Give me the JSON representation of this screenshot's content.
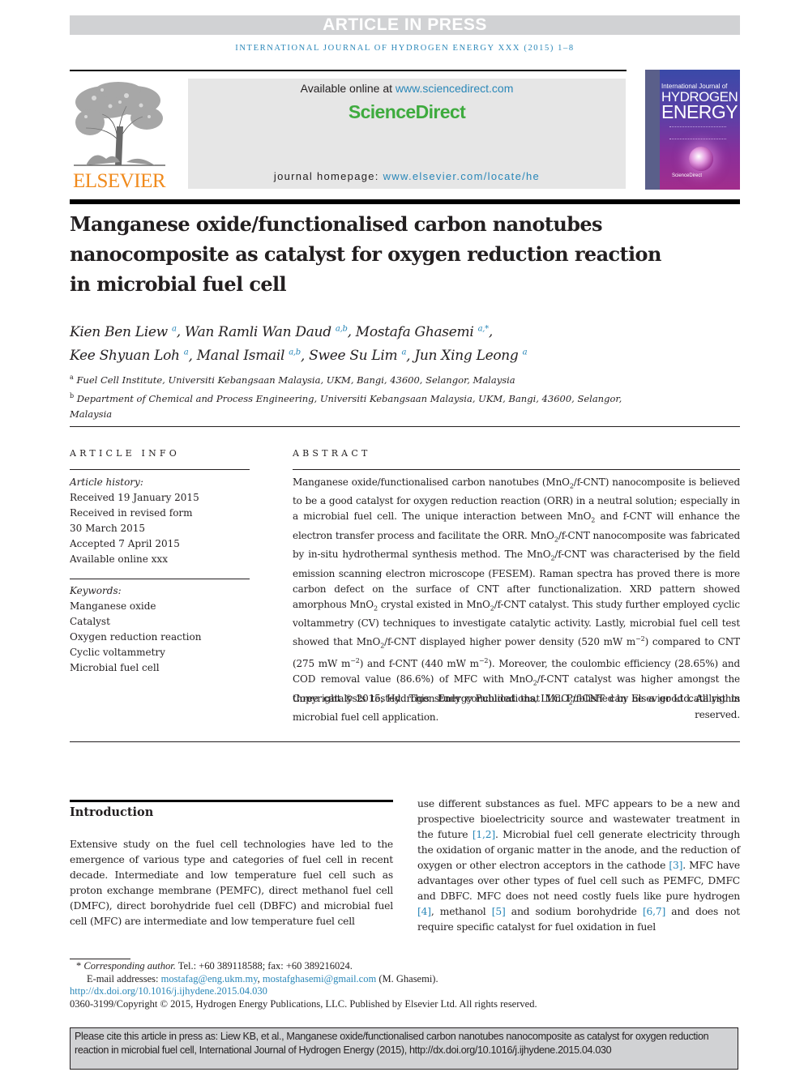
{
  "banner": {
    "label": "ARTICLE IN PRESS"
  },
  "running_head": "International Journal of Hydrogen Energy xxx (2015) 1–8",
  "masthead": {
    "publisher_word": "ELSEVIER",
    "available_prefix": "Available online at ",
    "available_link": "www.sciencedirect.com",
    "brand": "ScienceDirect",
    "homepage_prefix": "journal homepage: ",
    "homepage_link": "www.elsevier.com/locate/he",
    "cover": {
      "line1": "International Journal of",
      "line2": "HYDROGEN",
      "line3": "ENERGY",
      "footer": "ScienceDirect"
    }
  },
  "article": {
    "title": "Manganese oxide/functionalised carbon nanotubes nanocomposite as catalyst for oxygen reduction reaction in microbial fuel cell",
    "authors": [
      {
        "name": "Kien Ben Liew",
        "aff": "a",
        "sep": ", "
      },
      {
        "name": "Wan Ramli Wan Daud",
        "aff": "a,b",
        "sep": ", "
      },
      {
        "name": "Mostafa Ghasemi",
        "aff": "a,*",
        "sep": ","
      },
      {
        "name": "Kee Shyuan Loh",
        "aff": "a",
        "sep": ", "
      },
      {
        "name": "Manal Ismail",
        "aff": "a,b",
        "sep": ", "
      },
      {
        "name": "Swee Su Lim",
        "aff": "a",
        "sep": ", "
      },
      {
        "name": "Jun Xing Leong",
        "aff": "a",
        "sep": ""
      }
    ],
    "affiliations": [
      {
        "key": "a",
        "text": "Fuel Cell Institute, Universiti Kebangsaan Malaysia, UKM, Bangi, 43600, Selangor, Malaysia"
      },
      {
        "key": "b",
        "text": "Department of Chemical and Process Engineering, Universiti Kebangsaan Malaysia, UKM, Bangi, 43600, Selangor, Malaysia"
      }
    ]
  },
  "article_info": {
    "heading": "ARTICLE INFO",
    "history_label": "Article history:",
    "history": [
      "Received 19 January 2015",
      "Received in revised form",
      "30 March 2015",
      "Accepted 7 April 2015",
      "Available online xxx"
    ],
    "keywords_label": "Keywords:",
    "keywords": [
      "Manganese oxide",
      "Catalyst",
      "Oxygen reduction reaction",
      "Cyclic voltammetry",
      "Microbial fuel cell"
    ]
  },
  "abstract": {
    "heading": "ABSTRACT",
    "segments": [
      "Manganese oxide/functionalised carbon nanotubes (MnO",
      "2",
      "/f-CNT) nanocomposite is believed to be a good catalyst for oxygen reduction reaction (ORR) in a neutral solution; especially in a microbial fuel cell. The unique interaction between MnO",
      "2",
      " and f-CNT will enhance the electron transfer process and facilitate the ORR. MnO",
      "2",
      "/f-CNT nanocomposite was fabricated by in-situ hydrothermal synthesis method. The MnO",
      "2",
      "/f-CNT was characterised by the field emission scanning electron microscope (FESEM). Raman spectra has proved there is more carbon defect on the surface of CNT after functionalization. XRD pattern showed amorphous MnO",
      "2",
      " crystal existed in MnO",
      "2",
      "/f-CNT catalyst. This study further employed cyclic voltammetry (CV) techniques to investigate catalytic activity. Lastly, microbial fuel cell test showed that MnO",
      "2",
      "/f-CNT displayed higher power density (520 mW m",
      "−2",
      ") compared to CNT (275 mW m",
      "−2",
      ") and f-CNT (440 mW m",
      "−2",
      "). Moreover, the coulombic efficiency (28.65%) and COD removal value (86.6%) of MFC with MnO",
      "2",
      "/f-CNT catalyst was higher amongst the three catalysts tested. This study concluded that MnO",
      "2",
      "/f-CNT can be a good catalyst in microbial fuel cell application."
    ],
    "copyright": "Copyright © 2015, Hydrogen Energy Publications, LLC. Published by Elsevier Ltd. All rights reserved."
  },
  "introduction": {
    "heading": "Introduction",
    "col1": "Extensive study on the fuel cell technologies have led to the emergence of various type and categories of fuel cell in recent decade. Intermediate and low temperature fuel cell such as proton exchange membrane (PEMFC), direct methanol fuel cell (DMFC), direct borohydride fuel cell (DBFC) and microbial fuel cell (MFC) are intermediate and low temperature fuel cell",
    "col2": [
      {
        "t": "use different substances as fuel. MFC appears to be a new and prospective bioelectricity source and wastewater treatment in the future "
      },
      {
        "ref": "[1,2]"
      },
      {
        "t": ". Microbial fuel cell generate electricity through the oxidation of organic matter in the anode, and the reduction of oxygen or other electron acceptors in the cathode "
      },
      {
        "ref": "[3]"
      },
      {
        "t": ". MFC have advantages over other types of fuel cell such as PEMFC, DMFC and DBFC. MFC does not need costly fuels like pure hydrogen "
      },
      {
        "ref": "[4]"
      },
      {
        "t": ", methanol "
      },
      {
        "ref": "[5]"
      },
      {
        "t": " and sodium borohydride "
      },
      {
        "ref": "[6,7]"
      },
      {
        "t": " and does not require specific catalyst for fuel oxidation in fuel"
      }
    ]
  },
  "footnotes": {
    "star": "*",
    "corresponding_label": "Corresponding author.",
    "contact": " Tel.: +60 389118588; fax: +60 389216024.",
    "email_prefix": "E-mail addresses: ",
    "email1": "mostafag@eng.ukm.my",
    "email_sep": ", ",
    "email2": "mostafghasemi@gmail.com",
    "email_suffix": " (M. Ghasemi).",
    "doi": "http://dx.doi.org/10.1016/j.ijhydene.2015.04.030",
    "issn_copyright": "0360-3199/Copyright © 2015, Hydrogen Energy Publications, LLC. Published by Elsevier Ltd. All rights reserved."
  },
  "citation_box": {
    "text": "Please cite this article in press as: Liew KB, et al., Manganese oxide/functionalised carbon nanotubes nanocomposite as catalyst for oxygen reduction reaction in microbial fuel cell, International Journal of Hydrogen Energy (2015), http://dx.doi.org/10.1016/j.ijhydene.2015.04.030"
  },
  "colors": {
    "link": "#2a87b8",
    "sciencedirect_green": "#3eab3e",
    "elsevier_orange": "#f08a1c",
    "banner_gray": "#d1d2d4"
  }
}
